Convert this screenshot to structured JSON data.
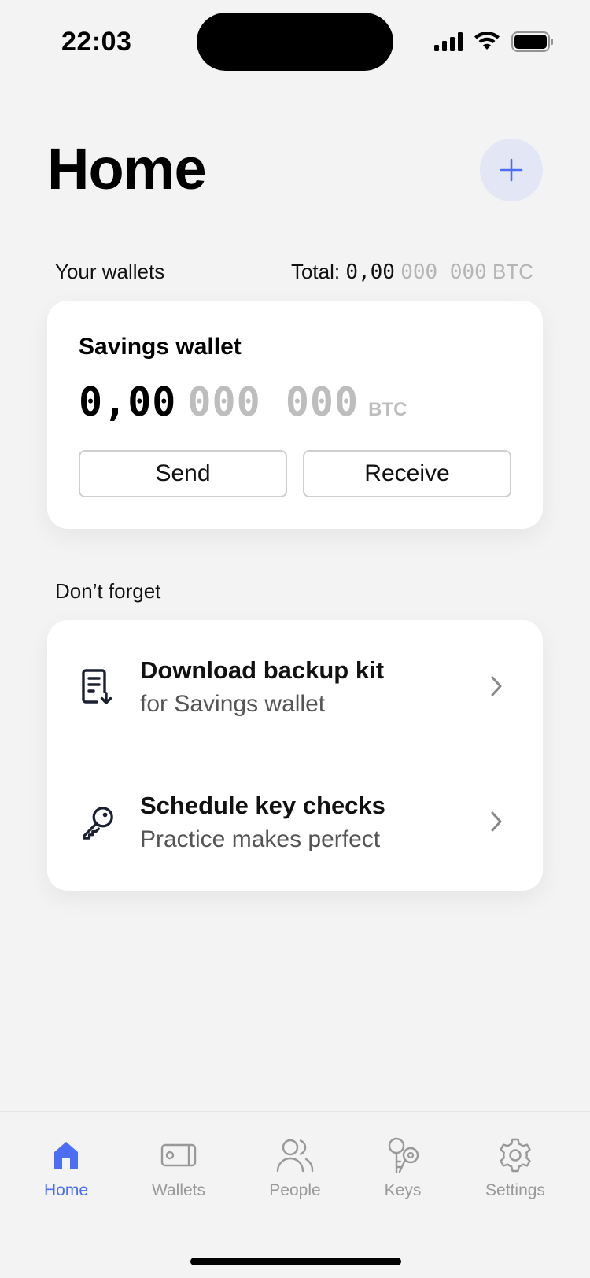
{
  "status_bar": {
    "time": "22:03"
  },
  "header": {
    "title": "Home",
    "add_icon": "plus-icon"
  },
  "wallets_section": {
    "label": "Your wallets",
    "total_prefix": "Total:",
    "total_main": "0,00",
    "total_rest": "000 000",
    "total_unit": "BTC"
  },
  "wallet_card": {
    "name": "Savings wallet",
    "balance_main": "0,00",
    "balance_rest": "000 000",
    "unit": "BTC",
    "send_label": "Send",
    "receive_label": "Receive"
  },
  "reminders": {
    "label": "Don’t forget",
    "items": [
      {
        "title": "Download backup kit",
        "subtitle": "for Savings wallet",
        "icon": "backup-document-icon"
      },
      {
        "title": "Schedule key checks",
        "subtitle": "Practice makes perfect",
        "icon": "key-icon"
      }
    ]
  },
  "tabbar": {
    "tabs": [
      {
        "label": "Home",
        "icon": "home-icon",
        "active": true
      },
      {
        "label": "Wallets",
        "icon": "wallet-icon",
        "active": false
      },
      {
        "label": "People",
        "icon": "people-icon",
        "active": false
      },
      {
        "label": "Keys",
        "icon": "keys-icon",
        "active": false
      },
      {
        "label": "Settings",
        "icon": "gear-icon",
        "active": false
      }
    ]
  },
  "colors": {
    "accent": "#4c6ef5",
    "accent_bg": "#e3e6f5",
    "background": "#f3f3f3",
    "muted": "#bdbdbd"
  }
}
